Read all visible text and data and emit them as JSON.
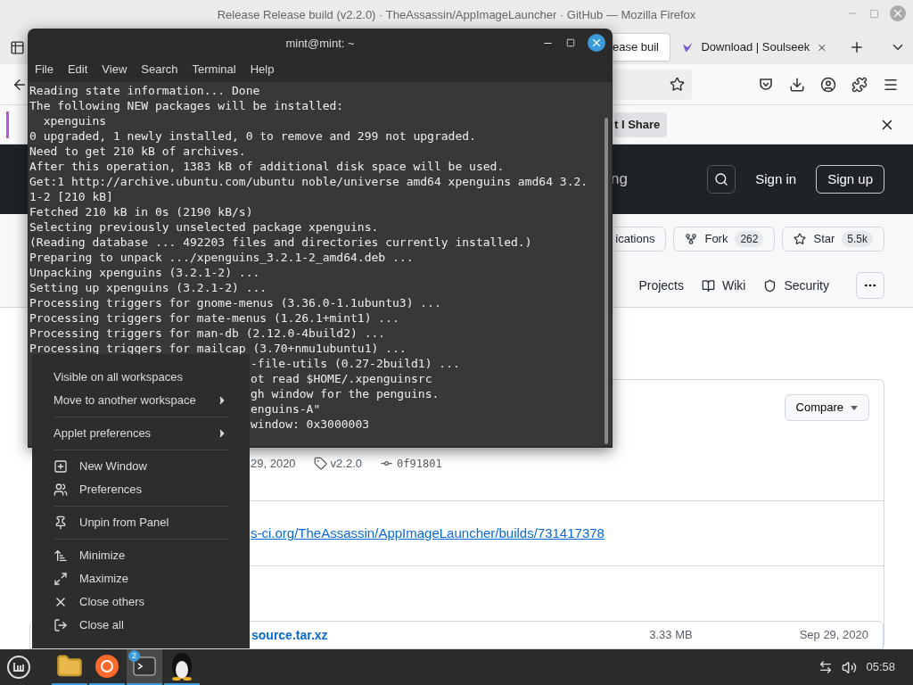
{
  "firefox": {
    "title": "Release Release build (v2.2.0) · TheAssassin/AppImageLauncher · GitHub — Mozilla Firefox",
    "tabs": [
      {
        "label": "ease buil",
        "selected": true
      },
      {
        "label": "Download | Soulseek",
        "selected": false
      }
    ],
    "notification": {
      "button": "t I Share"
    },
    "github": {
      "header_text": "ng",
      "sign_in": "Sign in",
      "sign_up": "Sign up",
      "actions": [
        {
          "kind": "plain",
          "label": "ications"
        },
        {
          "kind": "fork",
          "label": "Fork",
          "count": "262"
        },
        {
          "kind": "star",
          "label": "Star",
          "count": "5.5k"
        }
      ],
      "nav": [
        {
          "kind": "projects",
          "label": "Projects"
        },
        {
          "kind": "wiki",
          "label": "Wiki"
        },
        {
          "kind": "security",
          "label": "Security"
        }
      ],
      "release": {
        "compare": "Compare",
        "date": "29, 2020",
        "tag": "v2.2.0",
        "commit": "0f91801",
        "link": "s-ci.org/TheAssassin/AppImageLauncher/builds/731417378",
        "asset": {
          "name": "source.tar.xz",
          "size": "3.33 MB",
          "date": "Sep 29, 2020"
        }
      }
    }
  },
  "terminal": {
    "title": "mint@mint: ~",
    "menu": [
      "File",
      "Edit",
      "View",
      "Search",
      "Terminal",
      "Help"
    ],
    "lines": [
      {
        "kind": "full",
        "text": "Reading state information... Done"
      },
      {
        "kind": "full",
        "text": "The following NEW packages will be installed:"
      },
      {
        "kind": "full",
        "text": "  xpenguins"
      },
      {
        "kind": "full",
        "text": "0 upgraded, 1 newly installed, 0 to remove and 299 not upgraded."
      },
      {
        "kind": "full",
        "text": "Need to get 210 kB of archives."
      },
      {
        "kind": "full",
        "text": "After this operation, 1383 kB of additional disk space will be used."
      },
      {
        "kind": "full",
        "text": "Get:1 http://archive.ubuntu.com/ubuntu noble/universe amd64 xpenguins amd64 3.2."
      },
      {
        "kind": "full",
        "text": "1-2 [210 kB]"
      },
      {
        "kind": "full",
        "text": "Fetched 210 kB in 0s (2190 kB/s)"
      },
      {
        "kind": "full",
        "text": "Selecting previously unselected package xpenguins."
      },
      {
        "kind": "full",
        "text": "(Reading database ... 492203 files and directories currently installed.)"
      },
      {
        "kind": "full",
        "text": "Preparing to unpack .../xpenguins_3.2.1-2_amd64.deb ..."
      },
      {
        "kind": "full",
        "text": "Unpacking xpenguins (3.2.1-2) ..."
      },
      {
        "kind": "full",
        "text": "Setting up xpenguins (3.2.1-2) ..."
      },
      {
        "kind": "full",
        "text": "Processing triggers for gnome-menus (3.36.0-1.1ubuntu3) ..."
      },
      {
        "kind": "full",
        "text": "Processing triggers for mate-menus (1.26.1+mint1) ..."
      },
      {
        "kind": "full",
        "text": "Processing triggers for man-db (2.12.0-4build2) ..."
      },
      {
        "kind": "full",
        "text": "Processing triggers for mailcap (3.70+nmu1ubuntu1) ..."
      },
      {
        "kind": "partial",
        "text": "-file-utils (0.27-2build1) ..."
      },
      {
        "kind": "partial",
        "text": "ot read $HOME/.xpenguinsrc"
      },
      {
        "kind": "partial",
        "text": "gh window for the penguins."
      },
      {
        "kind": "partial",
        "text": "enguins-A\""
      },
      {
        "kind": "partial",
        "text": "window: 0x3000003"
      }
    ]
  },
  "context_menu": {
    "groups": [
      [
        {
          "kind": "plain",
          "label": "Visible on all workspaces"
        },
        {
          "kind": "submenu",
          "label": "Move to another workspace"
        }
      ],
      [
        {
          "kind": "submenu",
          "label": "Applet preferences"
        }
      ],
      [
        {
          "kind": "new-window",
          "label": "New Window"
        },
        {
          "kind": "preferences",
          "label": "Preferences"
        }
      ],
      [
        {
          "kind": "unpin",
          "label": "Unpin from Panel"
        }
      ],
      [
        {
          "kind": "minimize",
          "label": "Minimize"
        },
        {
          "kind": "maximize",
          "label": "Maximize"
        },
        {
          "kind": "close-others",
          "label": "Close others"
        },
        {
          "kind": "close-all",
          "label": "Close all"
        }
      ]
    ]
  },
  "taskbar": {
    "apps": [
      {
        "kind": "files",
        "selected": false
      },
      {
        "kind": "firefox",
        "selected": false
      },
      {
        "kind": "terminal",
        "selected": true,
        "badge": "2"
      },
      {
        "kind": "penguin",
        "selected": false
      }
    ],
    "clock": "05:58"
  }
}
